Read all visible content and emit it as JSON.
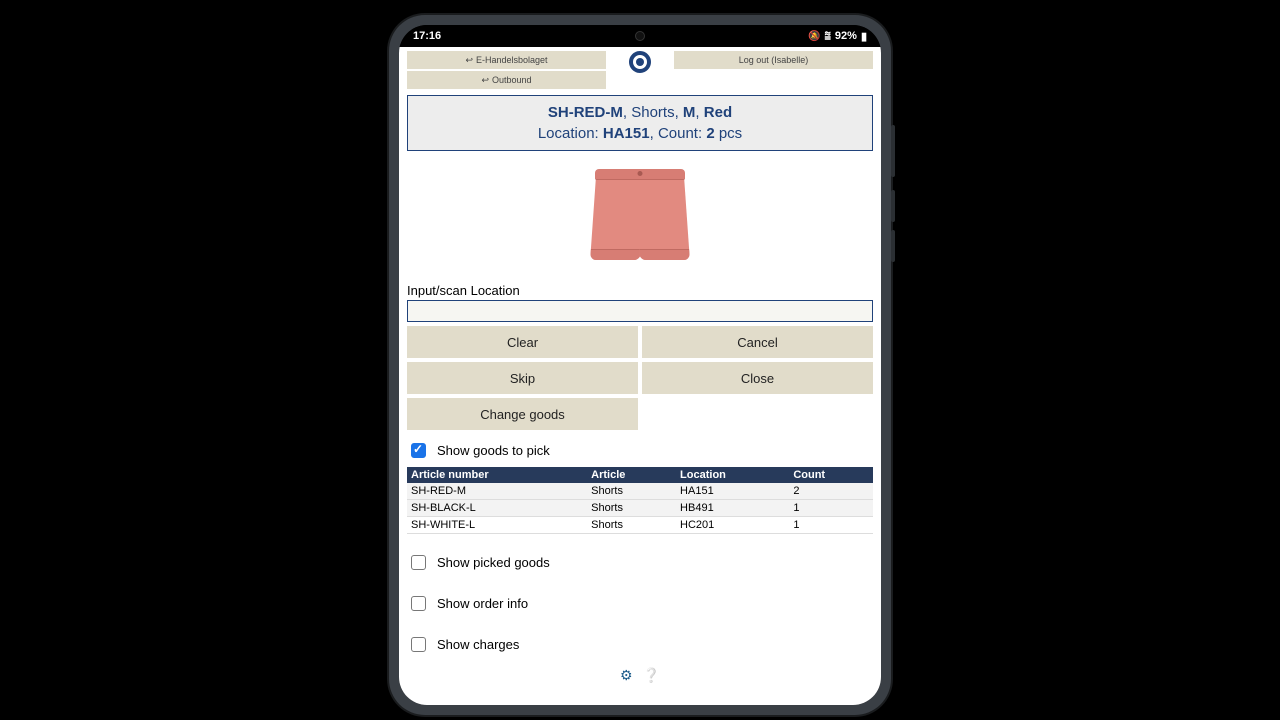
{
  "statusbar": {
    "time": "17:16",
    "battery": "92%"
  },
  "header": {
    "breadcrumbs": [
      "E-Handelsbolaget",
      "Outbound"
    ],
    "logout_label": "Log out (Isabelle)"
  },
  "item": {
    "sku": "SH-RED-M",
    "name": "Shorts",
    "size": "M",
    "color": "Red",
    "location_prefix": "Location:",
    "location": "HA151",
    "count_prefix": "Count:",
    "count": "2",
    "count_unit": "pcs"
  },
  "input": {
    "label": "Input/scan Location"
  },
  "buttons": {
    "clear": "Clear",
    "cancel": "Cancel",
    "skip": "Skip",
    "close": "Close",
    "change_goods": "Change goods"
  },
  "checkboxes": [
    {
      "label": "Show goods to pick",
      "checked": true
    },
    {
      "label": "Show picked goods",
      "checked": false
    },
    {
      "label": "Show order info",
      "checked": false
    },
    {
      "label": "Show charges",
      "checked": false
    }
  ],
  "table": {
    "headers": [
      "Article number",
      "Article",
      "Location",
      "Count"
    ],
    "rows": [
      {
        "article_number": "SH-RED-M",
        "article": "Shorts",
        "location": "HA151",
        "count": "2"
      },
      {
        "article_number": "SH-BLACK-L",
        "article": "Shorts",
        "location": "HB491",
        "count": "1"
      },
      {
        "article_number": "SH-WHITE-L",
        "article": "Shorts",
        "location": "HC201",
        "count": "1"
      }
    ]
  }
}
